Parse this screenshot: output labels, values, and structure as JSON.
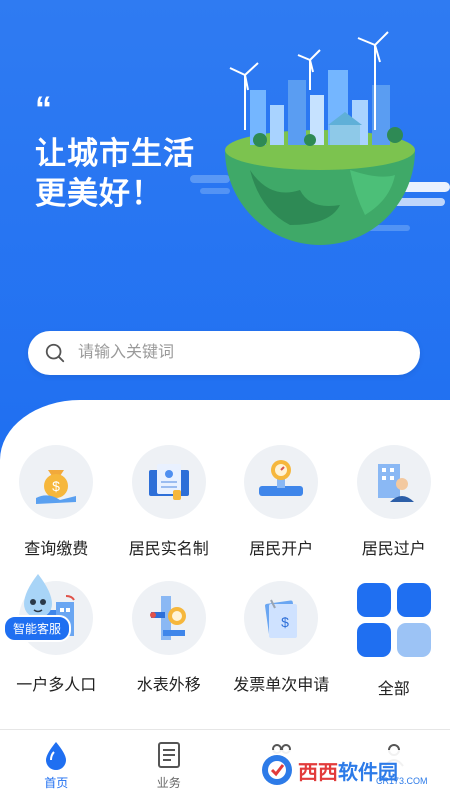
{
  "hero": {
    "quote_mark": "“",
    "slogan_line1": "让城市生活",
    "slogan_line2": "更美好！"
  },
  "search": {
    "placeholder": "请输入关键词"
  },
  "services": [
    {
      "label": "查询缴费",
      "icon": "money-bag-hand-icon"
    },
    {
      "label": "居民实名制",
      "icon": "id-card-icon"
    },
    {
      "label": "居民开户",
      "icon": "water-meter-icon"
    },
    {
      "label": "居民过户",
      "icon": "building-person-icon"
    },
    {
      "label": "一户多人口",
      "icon": "apartment-building-icon"
    },
    {
      "label": "水表外移",
      "icon": "meter-pipe-icon"
    },
    {
      "label": "发票单次申请",
      "icon": "invoice-icon"
    },
    {
      "label": "全部",
      "icon": "grid-tiles-icon"
    }
  ],
  "assistant": {
    "label": "智能客服"
  },
  "tabbar": {
    "items": [
      {
        "label": "首页",
        "icon": "water-drop-icon",
        "active": true
      },
      {
        "label": "业务",
        "icon": "document-list-icon",
        "active": false
      },
      {
        "label": "",
        "icon": "people-icon",
        "active": false
      },
      {
        "label": "",
        "icon": "user-icon",
        "active": false
      }
    ]
  },
  "watermark": {
    "brand_red": "西西",
    "brand_blue": "软件园",
    "site": "CR173.COM"
  },
  "colors": {
    "primary": "#1f6ff1",
    "hero_top": "#2f7bf2"
  }
}
